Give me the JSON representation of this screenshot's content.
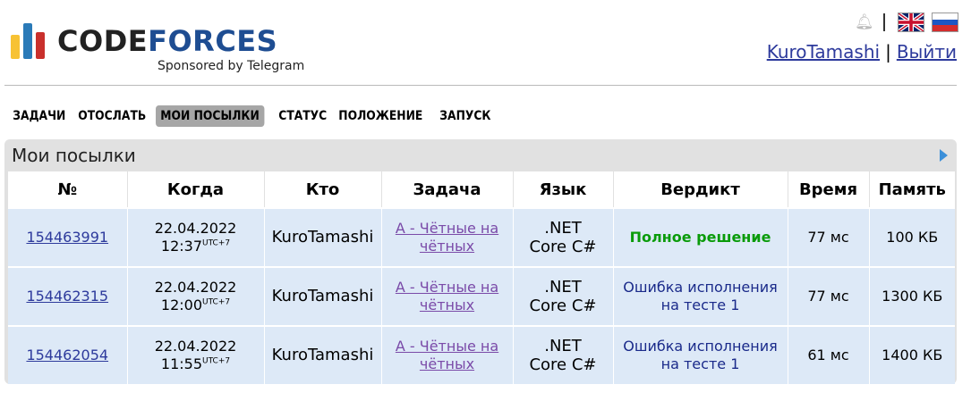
{
  "brand": {
    "name_part1": "CODE",
    "name_part2": "FORCES",
    "sponsor": "Sponsored by Telegram"
  },
  "user": {
    "name": "KuroTamashi",
    "separator": "|",
    "logout": "Выйти"
  },
  "header_icons": {
    "notifications": "bell-icon",
    "lang_en": "uk-flag-icon",
    "lang_ru": "ru-flag-icon"
  },
  "nav": {
    "items": [
      {
        "label": "ЗАДАЧИ"
      },
      {
        "label": "ОТОСЛАТЬ"
      },
      {
        "label": "МОИ ПОСЫЛКИ",
        "active": true
      },
      {
        "label": "СТАТУС"
      },
      {
        "label": "ПОЛОЖЕНИЕ"
      },
      {
        "label": "ЗАПУСК"
      }
    ]
  },
  "panel": {
    "title": "Мои посылки"
  },
  "table": {
    "headers": [
      "№",
      "Когда",
      "Кто",
      "Задача",
      "Язык",
      "Вердикт",
      "Время",
      "Память"
    ],
    "rows": [
      {
        "id": "154463991",
        "date": "22.04.2022",
        "time": "12:37",
        "tz": "UTC+7",
        "who": "KuroTamashi",
        "task_line1": "A - Чётные на",
        "task_line2": "чётных",
        "lang_line1": ".NET",
        "lang_line2": "Core C#",
        "verdict_line1": "Полное решение",
        "verdict_line2": "",
        "verdict_status": "ok",
        "runtime": "77 мс",
        "memory": "100 КБ"
      },
      {
        "id": "154462315",
        "date": "22.04.2022",
        "time": "12:00",
        "tz": "UTC+7",
        "who": "KuroTamashi",
        "task_line1": "A - Чётные на",
        "task_line2": "чётных",
        "lang_line1": ".NET",
        "lang_line2": "Core C#",
        "verdict_line1": "Ошибка исполнения",
        "verdict_line2": "на тесте 1",
        "verdict_status": "error",
        "runtime": "77 мс",
        "memory": "1300 КБ"
      },
      {
        "id": "154462054",
        "date": "22.04.2022",
        "time": "11:55",
        "tz": "UTC+7",
        "who": "KuroTamashi",
        "task_line1": "A - Чётные на",
        "task_line2": "чётных",
        "lang_line1": ".NET",
        "lang_line2": "Core C#",
        "verdict_line1": "Ошибка исполнения",
        "verdict_line2": "на тесте 1",
        "verdict_status": "error",
        "runtime": "61 мс",
        "memory": "1400 КБ"
      }
    ]
  },
  "colors": {
    "ok": "#0a9b0a",
    "error": "#1a2a8a",
    "link": "#2d3a9c",
    "visited_link": "#7a4aa8"
  }
}
